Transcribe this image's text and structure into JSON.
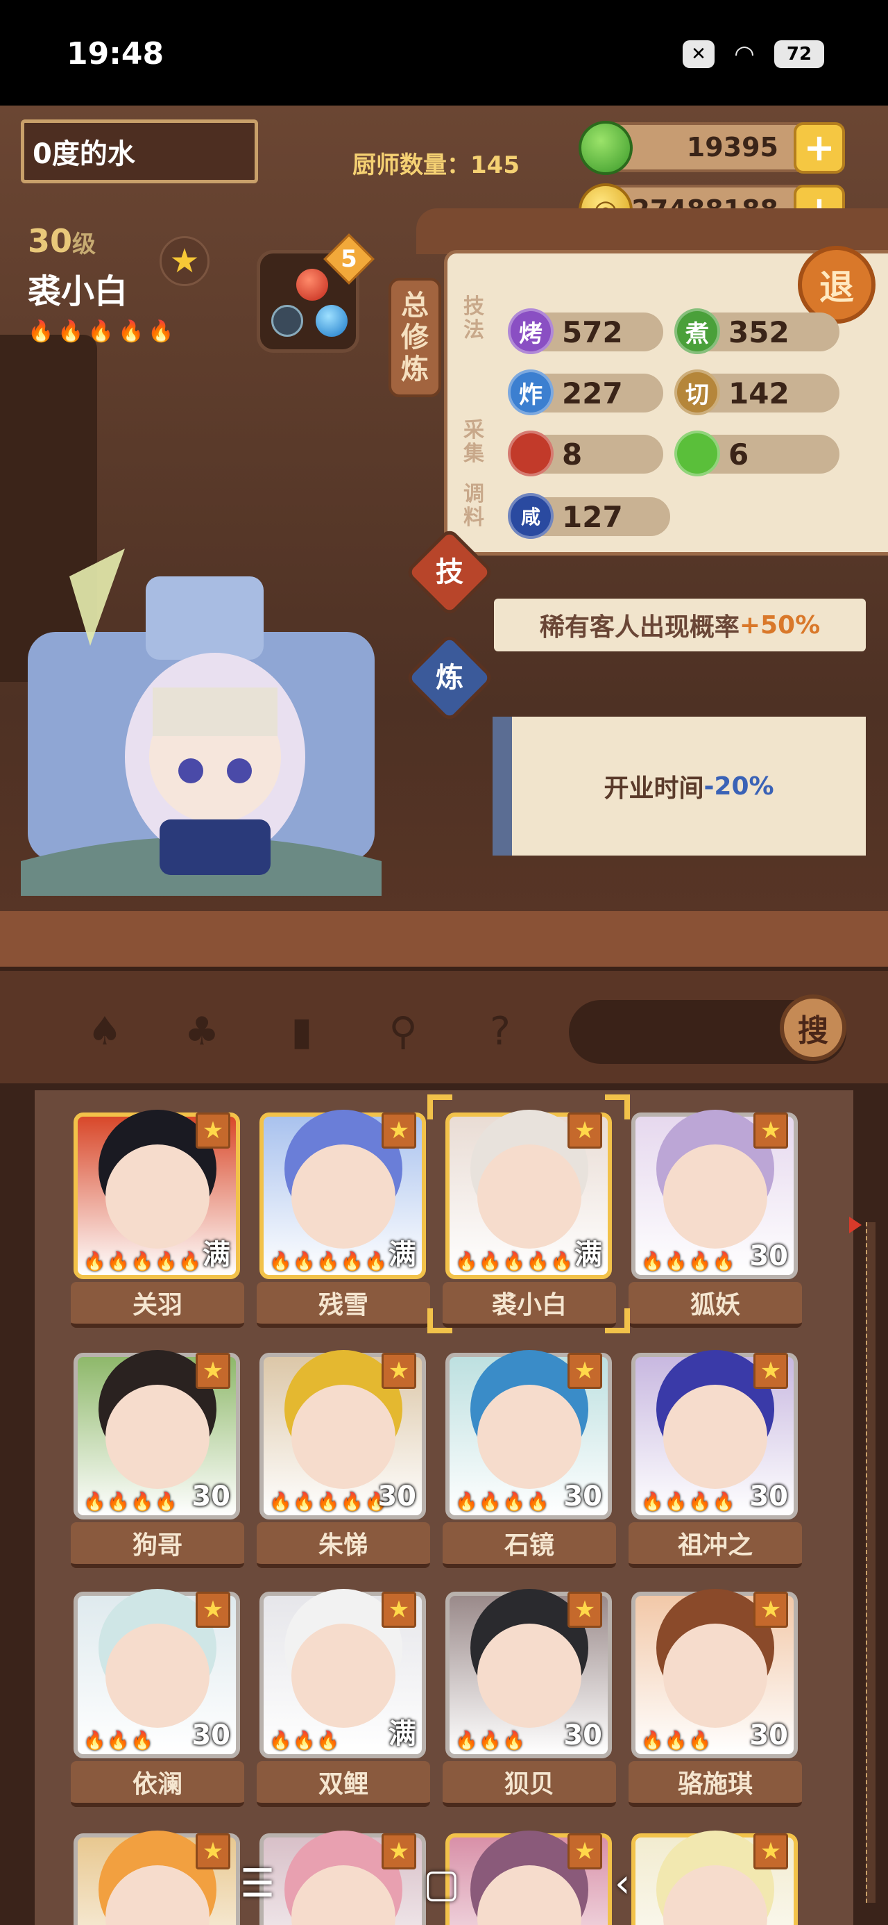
{
  "status_bar": {
    "time": "19:48",
    "battery": "72",
    "notif_icon": "x-box-icon",
    "wifi_icon": "wifi-icon"
  },
  "header": {
    "player_name": "0度的水",
    "chef_count_label": "厨师数量：145",
    "jade": "19395",
    "coins": "27488188"
  },
  "chef": {
    "level": "30",
    "level_unit": "级",
    "name": "裘小白",
    "flames": "🔥🔥🔥🔥🔥",
    "gear_count": "5"
  },
  "panel": {
    "tab_label_1": "总",
    "tab_label_2": "修",
    "tab_label_3": "炼",
    "cat_skill_1": "技",
    "cat_skill_2": "法",
    "cat_gather_1": "采",
    "cat_gather_2": "集",
    "cat_season_1": "调",
    "cat_season_2": "料",
    "exit_label": "退",
    "stats": [
      {
        "icon": "烤",
        "value": "572",
        "color": "#8a4fc3"
      },
      {
        "icon": "煮",
        "value": "352",
        "color": "#4aa03a"
      },
      {
        "icon": "炸",
        "value": "227",
        "color": "#3c7fd0"
      },
      {
        "icon": "切",
        "value": "142",
        "color": "#b5863a"
      },
      {
        "icon": "肉",
        "value": "8",
        "color": "#c23a2a"
      },
      {
        "icon": "菜",
        "value": "6",
        "color": "#5abf3a"
      },
      {
        "icon": "咸",
        "value": "127",
        "color": "#2a4aa0"
      }
    ],
    "skill_btn": "技",
    "refine_btn": "炼",
    "skill_desc_prefix": "稀有客人出现概率",
    "skill_desc_value": "+50%",
    "refine_desc_prefix": "开业时间",
    "refine_desc_value": "-20%"
  },
  "toolbar": {
    "tools": [
      "chef-hat-filter-icon",
      "spatula-icon",
      "jar-icon",
      "location-pin-icon",
      "map-question-icon"
    ],
    "search_label": "搜"
  },
  "chefs": [
    {
      "name": "关羽",
      "level": "满",
      "flames": "🔥🔥🔥🔥🔥",
      "gold": true,
      "hair": "#1a1a22",
      "bg": "#d8482a"
    },
    {
      "name": "残雪",
      "level": "满",
      "flames": "🔥🔥🔥🔥🔥",
      "gold": true,
      "hair": "#6a7ed8",
      "bg": "#a9c2ee"
    },
    {
      "name": "裘小白",
      "level": "满",
      "flames": "🔥🔥🔥🔥🔥",
      "gold": true,
      "hair": "#e8e2dc",
      "bg": "#e9dcd4"
    },
    {
      "name": "狐妖",
      "level": "30",
      "flames": "🔥🔥🔥🔥",
      "gold": false,
      "hair": "#bca6d6",
      "bg": "#e6d8ee"
    },
    {
      "name": "狗哥",
      "level": "30",
      "flames": "🔥🔥🔥🔥",
      "gold": false,
      "hair": "#2a2220",
      "bg": "#8eb86a"
    },
    {
      "name": "朱悌",
      "level": "30",
      "flames": "🔥🔥🔥🔥🔥",
      "gold": false,
      "hair": "#e4b830",
      "bg": "#dcc7a8"
    },
    {
      "name": "石镜",
      "level": "30",
      "flames": "🔥🔥🔥🔥",
      "gold": false,
      "hair": "#3a8cc8",
      "bg": "#bde0e0"
    },
    {
      "name": "祖冲之",
      "level": "30",
      "flames": "🔥🔥🔥🔥",
      "gold": false,
      "hair": "#3a3aa8",
      "bg": "#c8b8e0"
    },
    {
      "name": "依澜",
      "level": "30",
      "flames": "🔥🔥🔥",
      "gold": false,
      "hair": "#cfe6e6",
      "bg": "#dfeaee"
    },
    {
      "name": "双鲤",
      "level": "满",
      "flames": "🔥🔥🔥",
      "gold": false,
      "hair": "#f2f2f2",
      "bg": "#e6e6ea"
    },
    {
      "name": "狈贝",
      "level": "30",
      "flames": "🔥🔥🔥",
      "gold": false,
      "hair": "#2a2a2e",
      "bg": "#9a8a8a"
    },
    {
      "name": "骆施琪",
      "level": "30",
      "flames": "🔥🔥🔥",
      "gold": false,
      "hair": "#8a4a2a",
      "bg": "#f2c8a8"
    },
    {
      "name": "",
      "level": "",
      "flames": "",
      "gold": false,
      "hair": "#f2a040",
      "bg": "#e8c890"
    },
    {
      "name": "",
      "level": "",
      "flames": "",
      "gold": false,
      "hair": "#e8a0b0",
      "bg": "#d8c0c8"
    },
    {
      "name": "",
      "level": "",
      "flames": "",
      "gold": true,
      "hair": "#8a5a7a",
      "bg": "#d890a8"
    },
    {
      "name": "",
      "level": "",
      "flames": "",
      "gold": true,
      "hair": "#f2e8b0",
      "bg": "#f2ecd0"
    }
  ],
  "navbar": {
    "menu": "☰",
    "home": "▢",
    "back": "‹"
  }
}
